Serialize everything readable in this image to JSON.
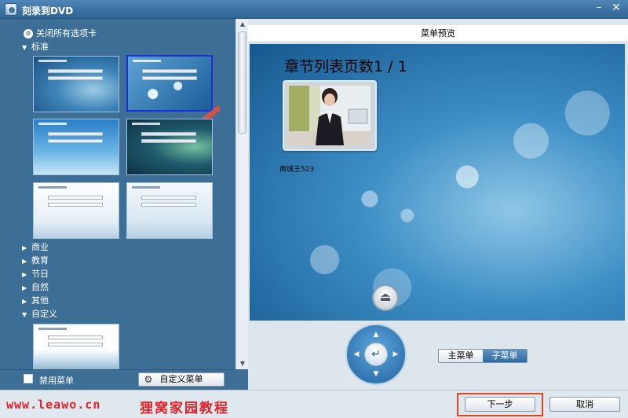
{
  "window": {
    "title": "刻录到DVD",
    "minimize_icon": "minimize-icon",
    "close_icon": "close-icon"
  },
  "left_panel": {
    "close_tabs_label": "关闭所有选项卡",
    "categories": [
      {
        "label": "标准",
        "expanded": true
      },
      {
        "label": "商业",
        "expanded": false
      },
      {
        "label": "教育",
        "expanded": false
      },
      {
        "label": "节日",
        "expanded": false
      },
      {
        "label": "自然",
        "expanded": false
      },
      {
        "label": "其他",
        "expanded": false
      },
      {
        "label": "自定义",
        "expanded": true
      }
    ],
    "standard_templates": [
      {
        "name": "template-blue-swirl",
        "selected": false
      },
      {
        "name": "template-bokeh-blue",
        "selected": true
      },
      {
        "name": "template-sky-blue",
        "selected": false
      },
      {
        "name": "template-dark-teal",
        "selected": false
      },
      {
        "name": "template-white-clean",
        "selected": false
      },
      {
        "name": "template-light-gradient",
        "selected": false
      }
    ],
    "custom_templates": [
      {
        "name": "template-custom-white",
        "selected": false
      }
    ],
    "disable_menu_label": "禁用菜单",
    "disable_menu_checked": false,
    "custom_menu_button": "自定义菜单"
  },
  "right_panel": {
    "preview_header": "菜单预览",
    "chapter_title": "章节列表页数1 / 1",
    "chapter_name": "商城王523",
    "main_menu_label": "主菜单",
    "sub_menu_label": "子菜单",
    "active_menu": "子菜单"
  },
  "footer": {
    "watermark_url": "www.leawo.cn",
    "watermark_cn": "狸窝家园教程",
    "next_button": "下一步",
    "cancel_button": "取消"
  },
  "colors": {
    "selection_border": "#1b2ee0",
    "checkmark": "#e05040",
    "highlight_box": "#e2431f",
    "watermark": "#e0242a",
    "panel_bg": "#3d6e96"
  }
}
